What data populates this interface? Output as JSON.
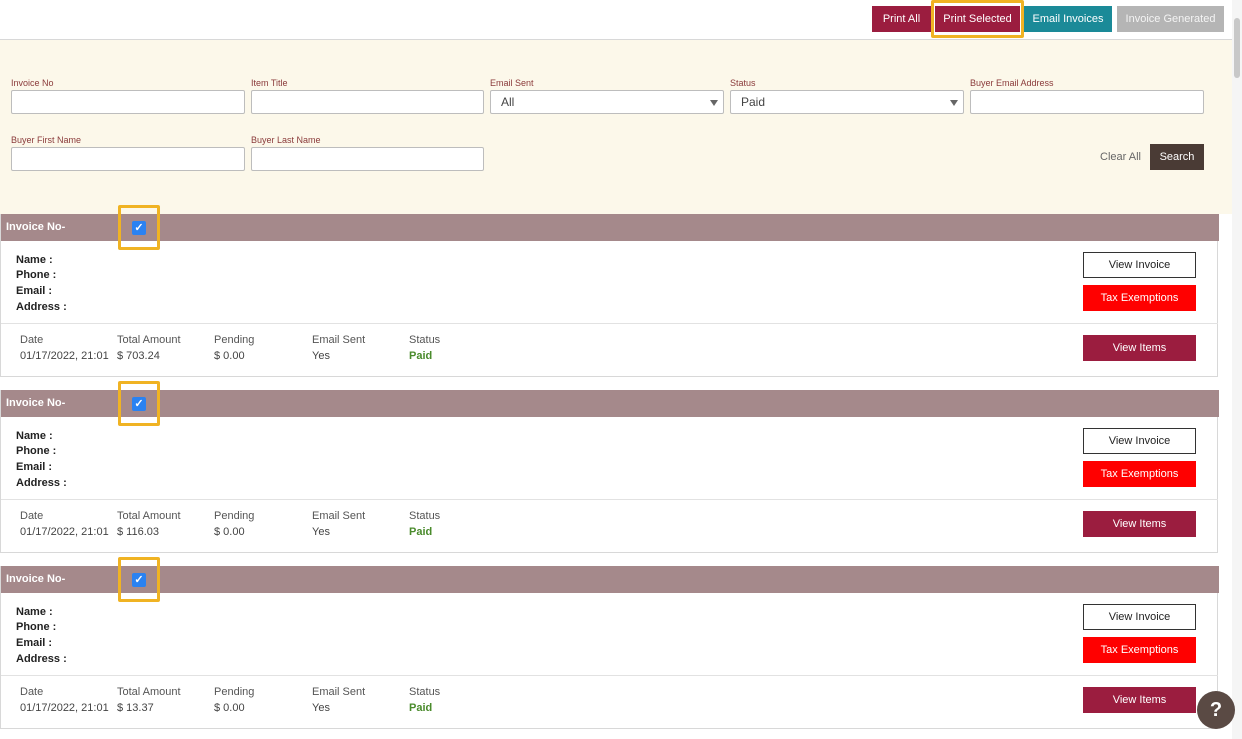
{
  "toolbar": {
    "print_all": "Print All",
    "print_selected": "Print Selected",
    "email_invoices": "Email Invoices",
    "invoice_generated": "Invoice Generated"
  },
  "filters": {
    "invoice_no_label": "Invoice No",
    "invoice_no_value": "",
    "item_title_label": "Item Title",
    "item_title_value": "",
    "email_sent_label": "Email Sent",
    "email_sent_value": "All",
    "status_label": "Status",
    "status_value": "Paid",
    "buyer_email_label": "Buyer Email Address",
    "buyer_email_value": "",
    "buyer_first_label": "Buyer First Name",
    "buyer_first_value": "",
    "buyer_last_label": "Buyer Last Name",
    "buyer_last_value": "",
    "clear_all": "Clear All",
    "search": "Search"
  },
  "labels": {
    "invoice_no": "Invoice No-",
    "name": "Name :",
    "phone": "Phone :",
    "email": "Email :",
    "address": "Address :",
    "date": "Date",
    "total_amount": "Total Amount",
    "pending": "Pending",
    "email_sent": "Email Sent",
    "status": "Status",
    "view_invoice": "View Invoice",
    "tax_exemptions": "Tax Exemptions",
    "view_items": "View Items",
    "checkmark": "✓"
  },
  "invoices": [
    {
      "date": "01/17/2022, 21:01",
      "total": "$ 703.24",
      "pending": "$ 0.00",
      "email_sent": "Yes",
      "status": "Paid",
      "checked": true
    },
    {
      "date": "01/17/2022, 21:01",
      "total": "$ 116.03",
      "pending": "$ 0.00",
      "email_sent": "Yes",
      "status": "Paid",
      "checked": true
    },
    {
      "date": "01/17/2022, 21:01",
      "total": "$ 13.37",
      "pending": "$ 0.00",
      "email_sent": "Yes",
      "status": "Paid",
      "checked": true
    }
  ],
  "help": {
    "label": "?"
  },
  "colors": {
    "primary": "#9b1d3f",
    "teal": "#1b8a98",
    "header_band": "#a5898b",
    "filter_bg": "#fcf8ea",
    "tax_red": "#ff0000",
    "highlight": "#f0b323"
  },
  "icons": {
    "checkbox": "checkbox-checked-icon",
    "help": "help-icon",
    "dropdown": "chevron-down-icon"
  }
}
